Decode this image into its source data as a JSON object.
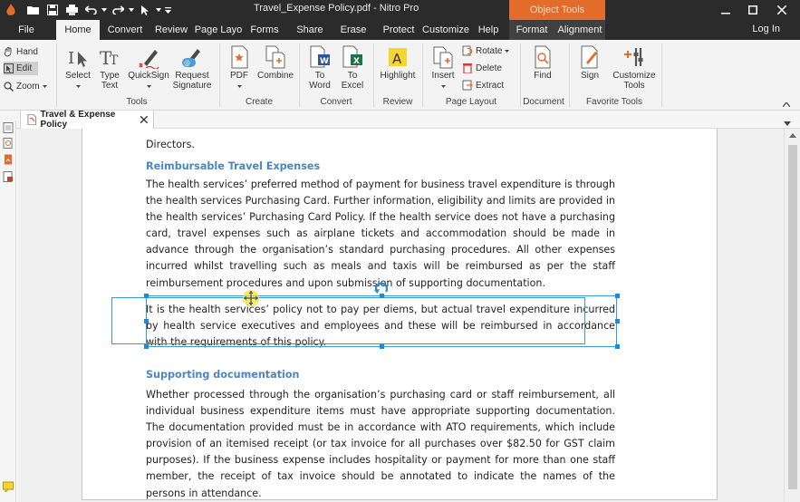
{
  "app": {
    "window_title": "Travel_Expense Policy.pdf - Nitro Pro",
    "context_tab_header": "Object Tools",
    "login_label": "Log In"
  },
  "ribbon_tabs": [
    {
      "label": "File"
    },
    {
      "label": "Home"
    },
    {
      "label": "Convert"
    },
    {
      "label": "Review"
    },
    {
      "label": "Page Layo"
    },
    {
      "label": "Forms"
    },
    {
      "label": "Share"
    },
    {
      "label": "Erase"
    },
    {
      "label": "Protect"
    },
    {
      "label": "Customize"
    },
    {
      "label": "Help"
    },
    {
      "label": "Format"
    },
    {
      "label": "Alignment"
    }
  ],
  "ribbon": {
    "modes": {
      "hand": "Hand",
      "edit": "Edit",
      "zoom": "Zoom"
    },
    "tools": {
      "select": "Select",
      "type_text_1": "Type",
      "type_text_2": "Text",
      "quicksign": "QuickSign",
      "request_1": "Request",
      "request_2": "Signature",
      "group": "Tools"
    },
    "create": {
      "pdf": "PDF",
      "combine": "Combine",
      "group": "Create"
    },
    "convert": {
      "to_word_1": "To",
      "to_word_2": "Word",
      "to_excel_1": "To",
      "to_excel_2": "Excel",
      "group": "Convert"
    },
    "review": {
      "highlight": "Highlight",
      "group": "Review"
    },
    "page_layout": {
      "insert": "Insert",
      "rotate": "Rotate",
      "delete": "Delete",
      "extract": "Extract",
      "group": "Page Layout"
    },
    "document": {
      "find": "Find",
      "group": "Document"
    },
    "favorite": {
      "sign": "Sign",
      "customize_1": "Customize",
      "customize_2": "Tools",
      "group": "Favorite Tools"
    }
  },
  "document_tab": {
    "label": "Travel & Expense Policy"
  },
  "doc": {
    "fragment_top": "Directors.",
    "heading1": "Reimbursable Travel Expenses",
    "para1": "The health services’ preferred method of payment for business travel expenditure is through the health services Purchasing Card. Further information, eligibility and limits are provided in the health services’ Purchasing Card Policy. If the health service does not have a purchasing card, travel expenses such as airplane tickets and accommodation should be made in advance through the organisation’s standard purchasing procedures. All other expenses incurred whilst travelling such as meals and taxis will be reimbursed as per the staff reimbursement procedures and upon submission of supporting documentation.",
    "para2": "It is the health services’ policy not to pay per diems, but actual travel expenditure incurred by health service executives and employees and these will be reimbursed in accordance with the requirements of this policy.",
    "heading2": "Supporting documentation",
    "para3": "Whether processed through the organisation’s purchasing card or staff reimbursement, all individual business expenditure items must have appropriate supporting documentation. The documentation provided must be in accordance with ATO requirements, which include provision of an itemised receipt (or tax invoice for all purchases over $82.50 for GST claim purposes). If the business expense includes hospitality or payment for more than one staff member, the receipt of tax invoice should be annotated to indicate the names of the persons in attendance."
  },
  "colors": {
    "titlebar": "#2b2b2b",
    "accent_orange": "#e46c2a",
    "heading_blue": "#4a86c0",
    "selection_blue": "#3a9ad9"
  }
}
